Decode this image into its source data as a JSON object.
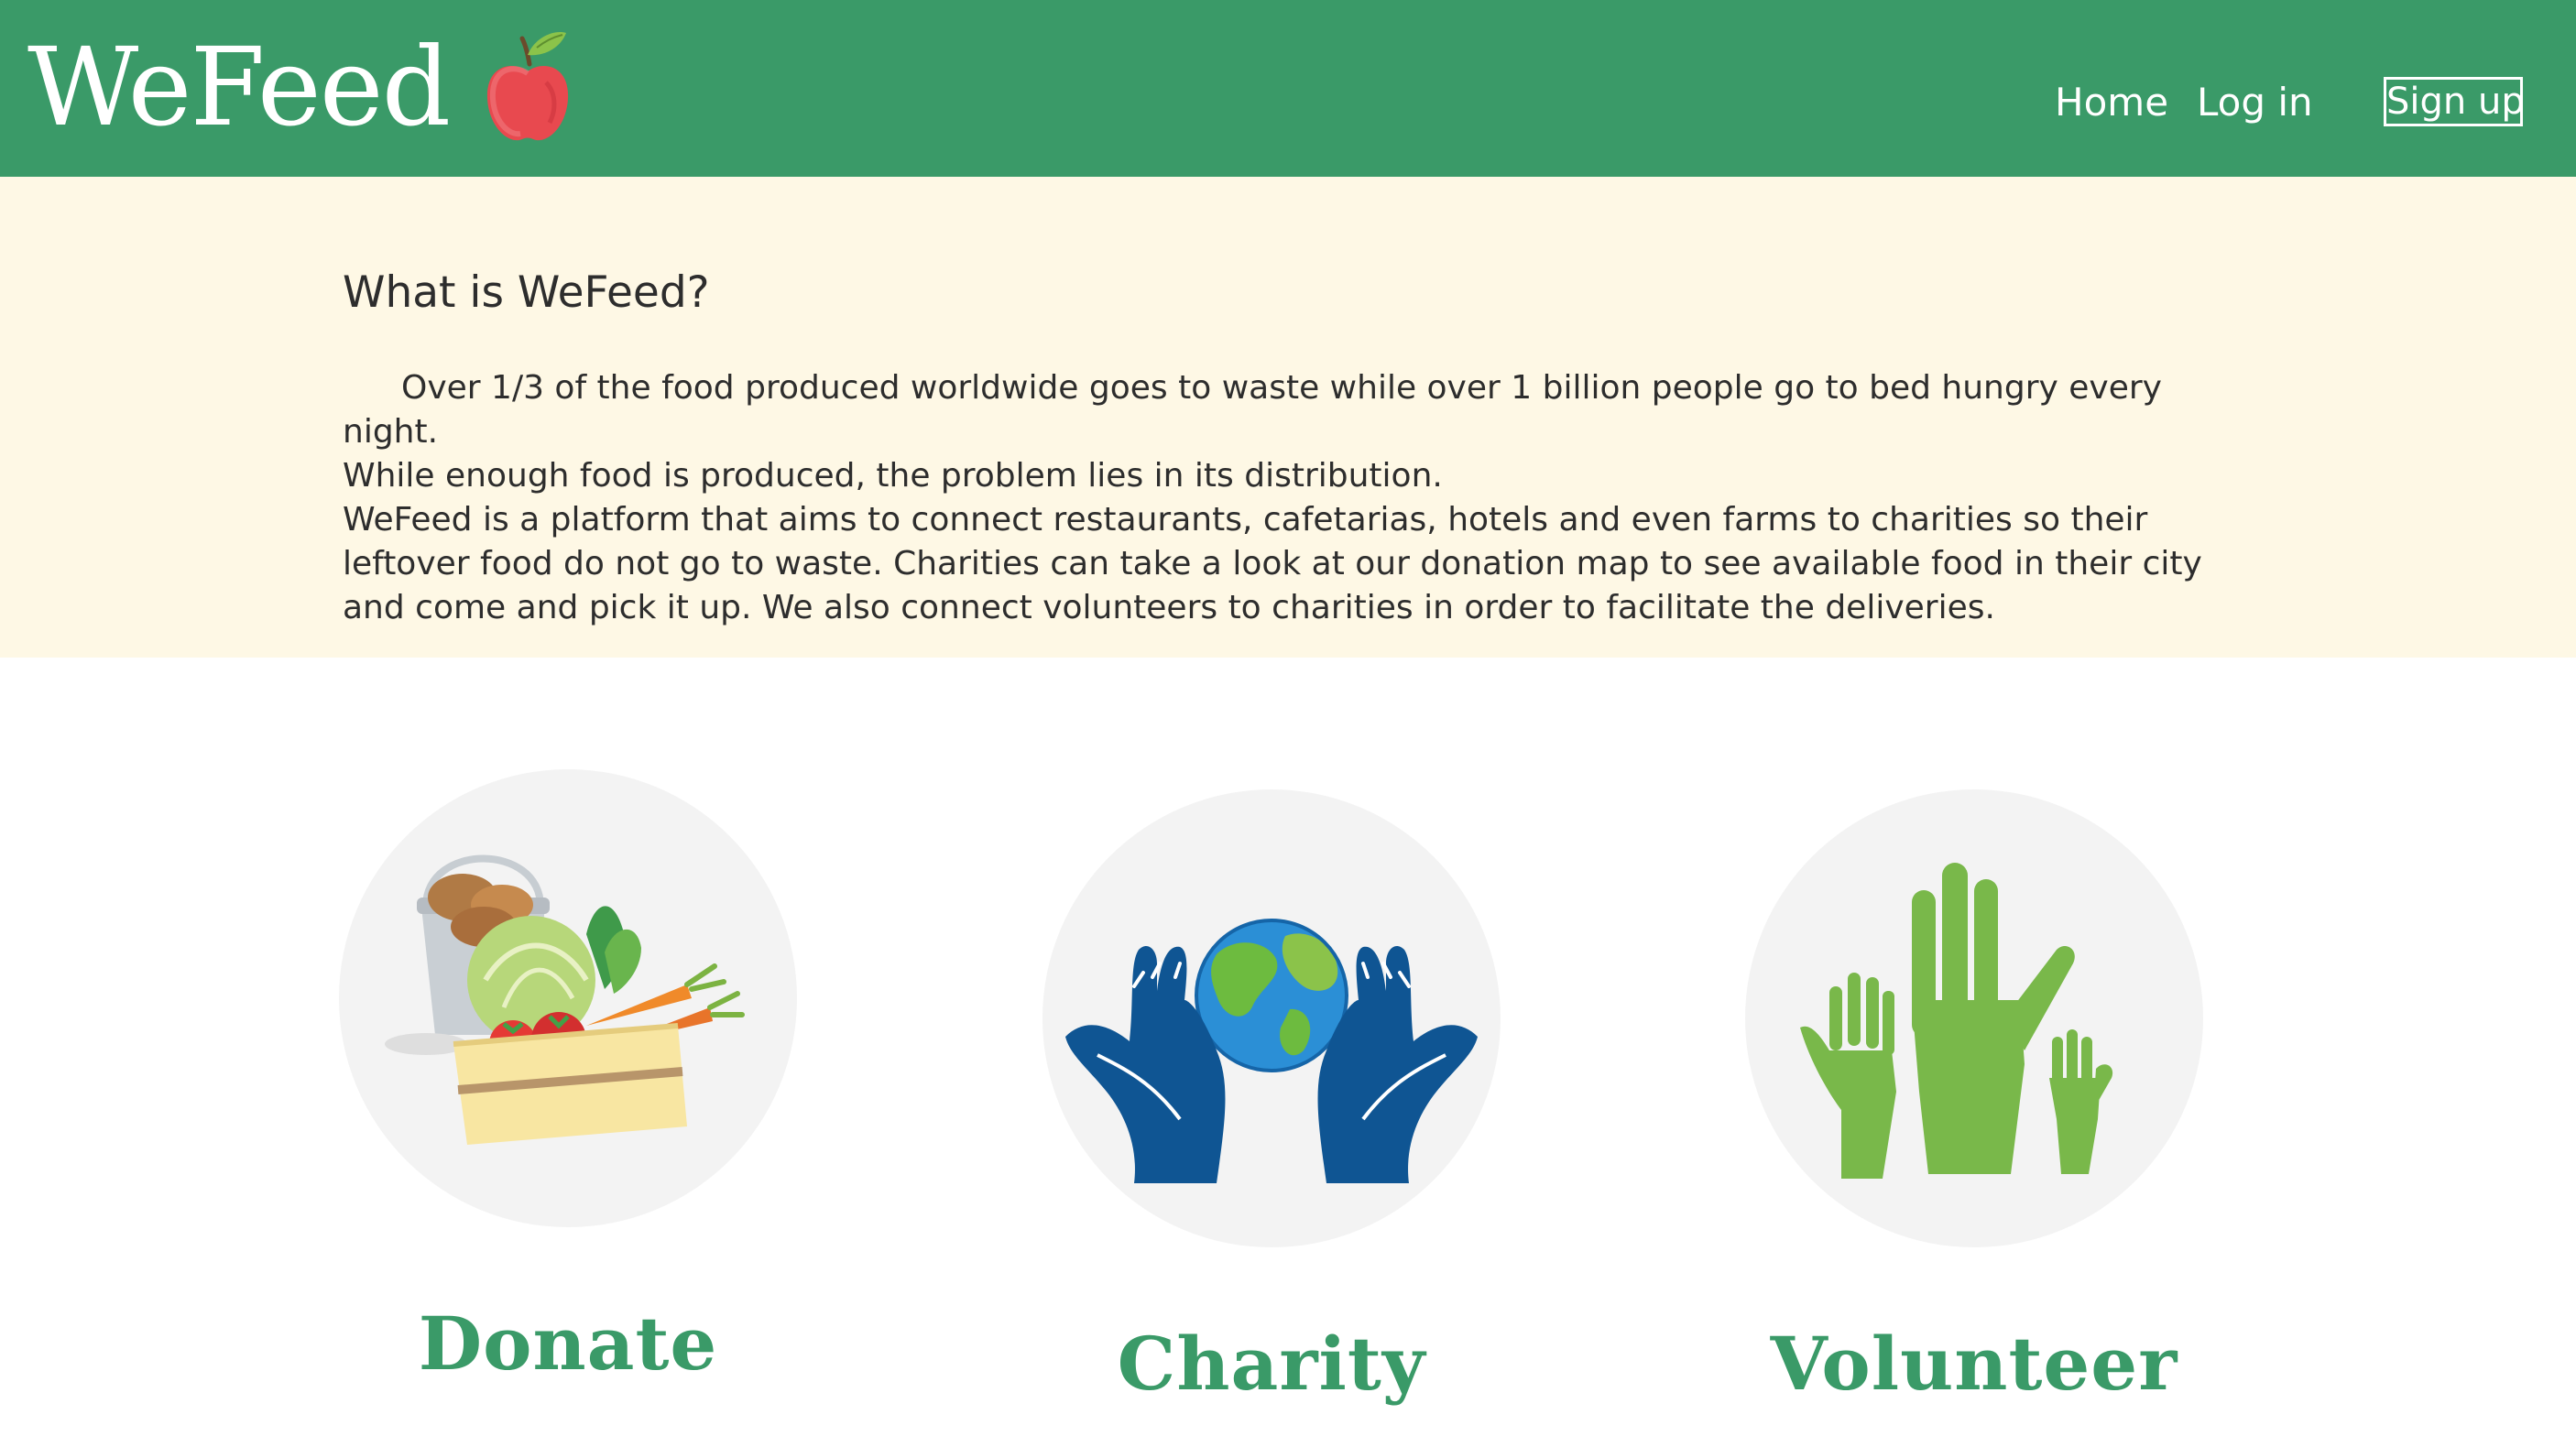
{
  "brand": {
    "name": "WeFeed",
    "logo_icon": "apple-icon",
    "colors": {
      "primary": "#3a9a68",
      "band": "#fef8e5"
    }
  },
  "nav": {
    "home": "Home",
    "login": "Log in",
    "signup": "Sign up"
  },
  "about": {
    "title": "What is WeFeed?",
    "paragraphs": [
      "Over 1/3 of the food produced worldwide goes to waste while over 1 billion people go to bed hungry every night.",
      "While enough food is produced, the problem lies in its distribution.",
      "WeFeed is a platform that aims to connect restaurants, cafetarias, hotels and even farms to charities so their leftover food do not go to waste. Charities can take a look at our donation map to see available food in their city and come and pick it up. We also connect volunteers to charities in order to facilitate the deliveries."
    ]
  },
  "cards": [
    {
      "label": "Donate",
      "icon": "food-basket-icon"
    },
    {
      "label": "Charity",
      "icon": "hands-globe-icon"
    },
    {
      "label": "Volunteer",
      "icon": "raised-hands-icon"
    }
  ]
}
